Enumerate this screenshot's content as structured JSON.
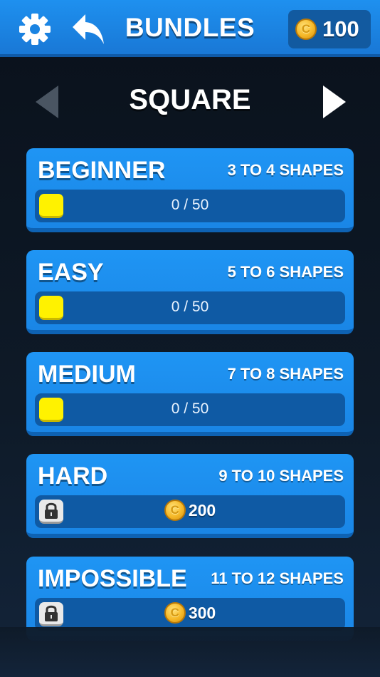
{
  "header": {
    "title": "BUNDLES",
    "coins": "100"
  },
  "selector": {
    "category": "SQUARE"
  },
  "bundles": [
    {
      "name": "BEGINNER",
      "shapes": "3 TO 4 SHAPES",
      "progress": "0 / 50",
      "locked": false
    },
    {
      "name": "EASY",
      "shapes": "5 TO 6 SHAPES",
      "progress": "0 / 50",
      "locked": false
    },
    {
      "name": "MEDIUM",
      "shapes": "7 TO 8 SHAPES",
      "progress": "0 / 50",
      "locked": false
    },
    {
      "name": "HARD",
      "shapes": "9 TO 10 SHAPES",
      "price": "200",
      "locked": true
    },
    {
      "name": "IMPOSSIBLE",
      "shapes": "11 TO 12 SHAPES",
      "price": "300",
      "locked": true
    }
  ],
  "colors": {
    "header": "#1e90ef",
    "card": "#1f95f4",
    "bar": "#0f5aa4",
    "square": "#fff200",
    "background": "#0a111b"
  },
  "icons": [
    "gear-icon",
    "back-arrow-icon",
    "coin-icon",
    "chevron-left-icon",
    "chevron-right-icon",
    "lock-icon"
  ]
}
